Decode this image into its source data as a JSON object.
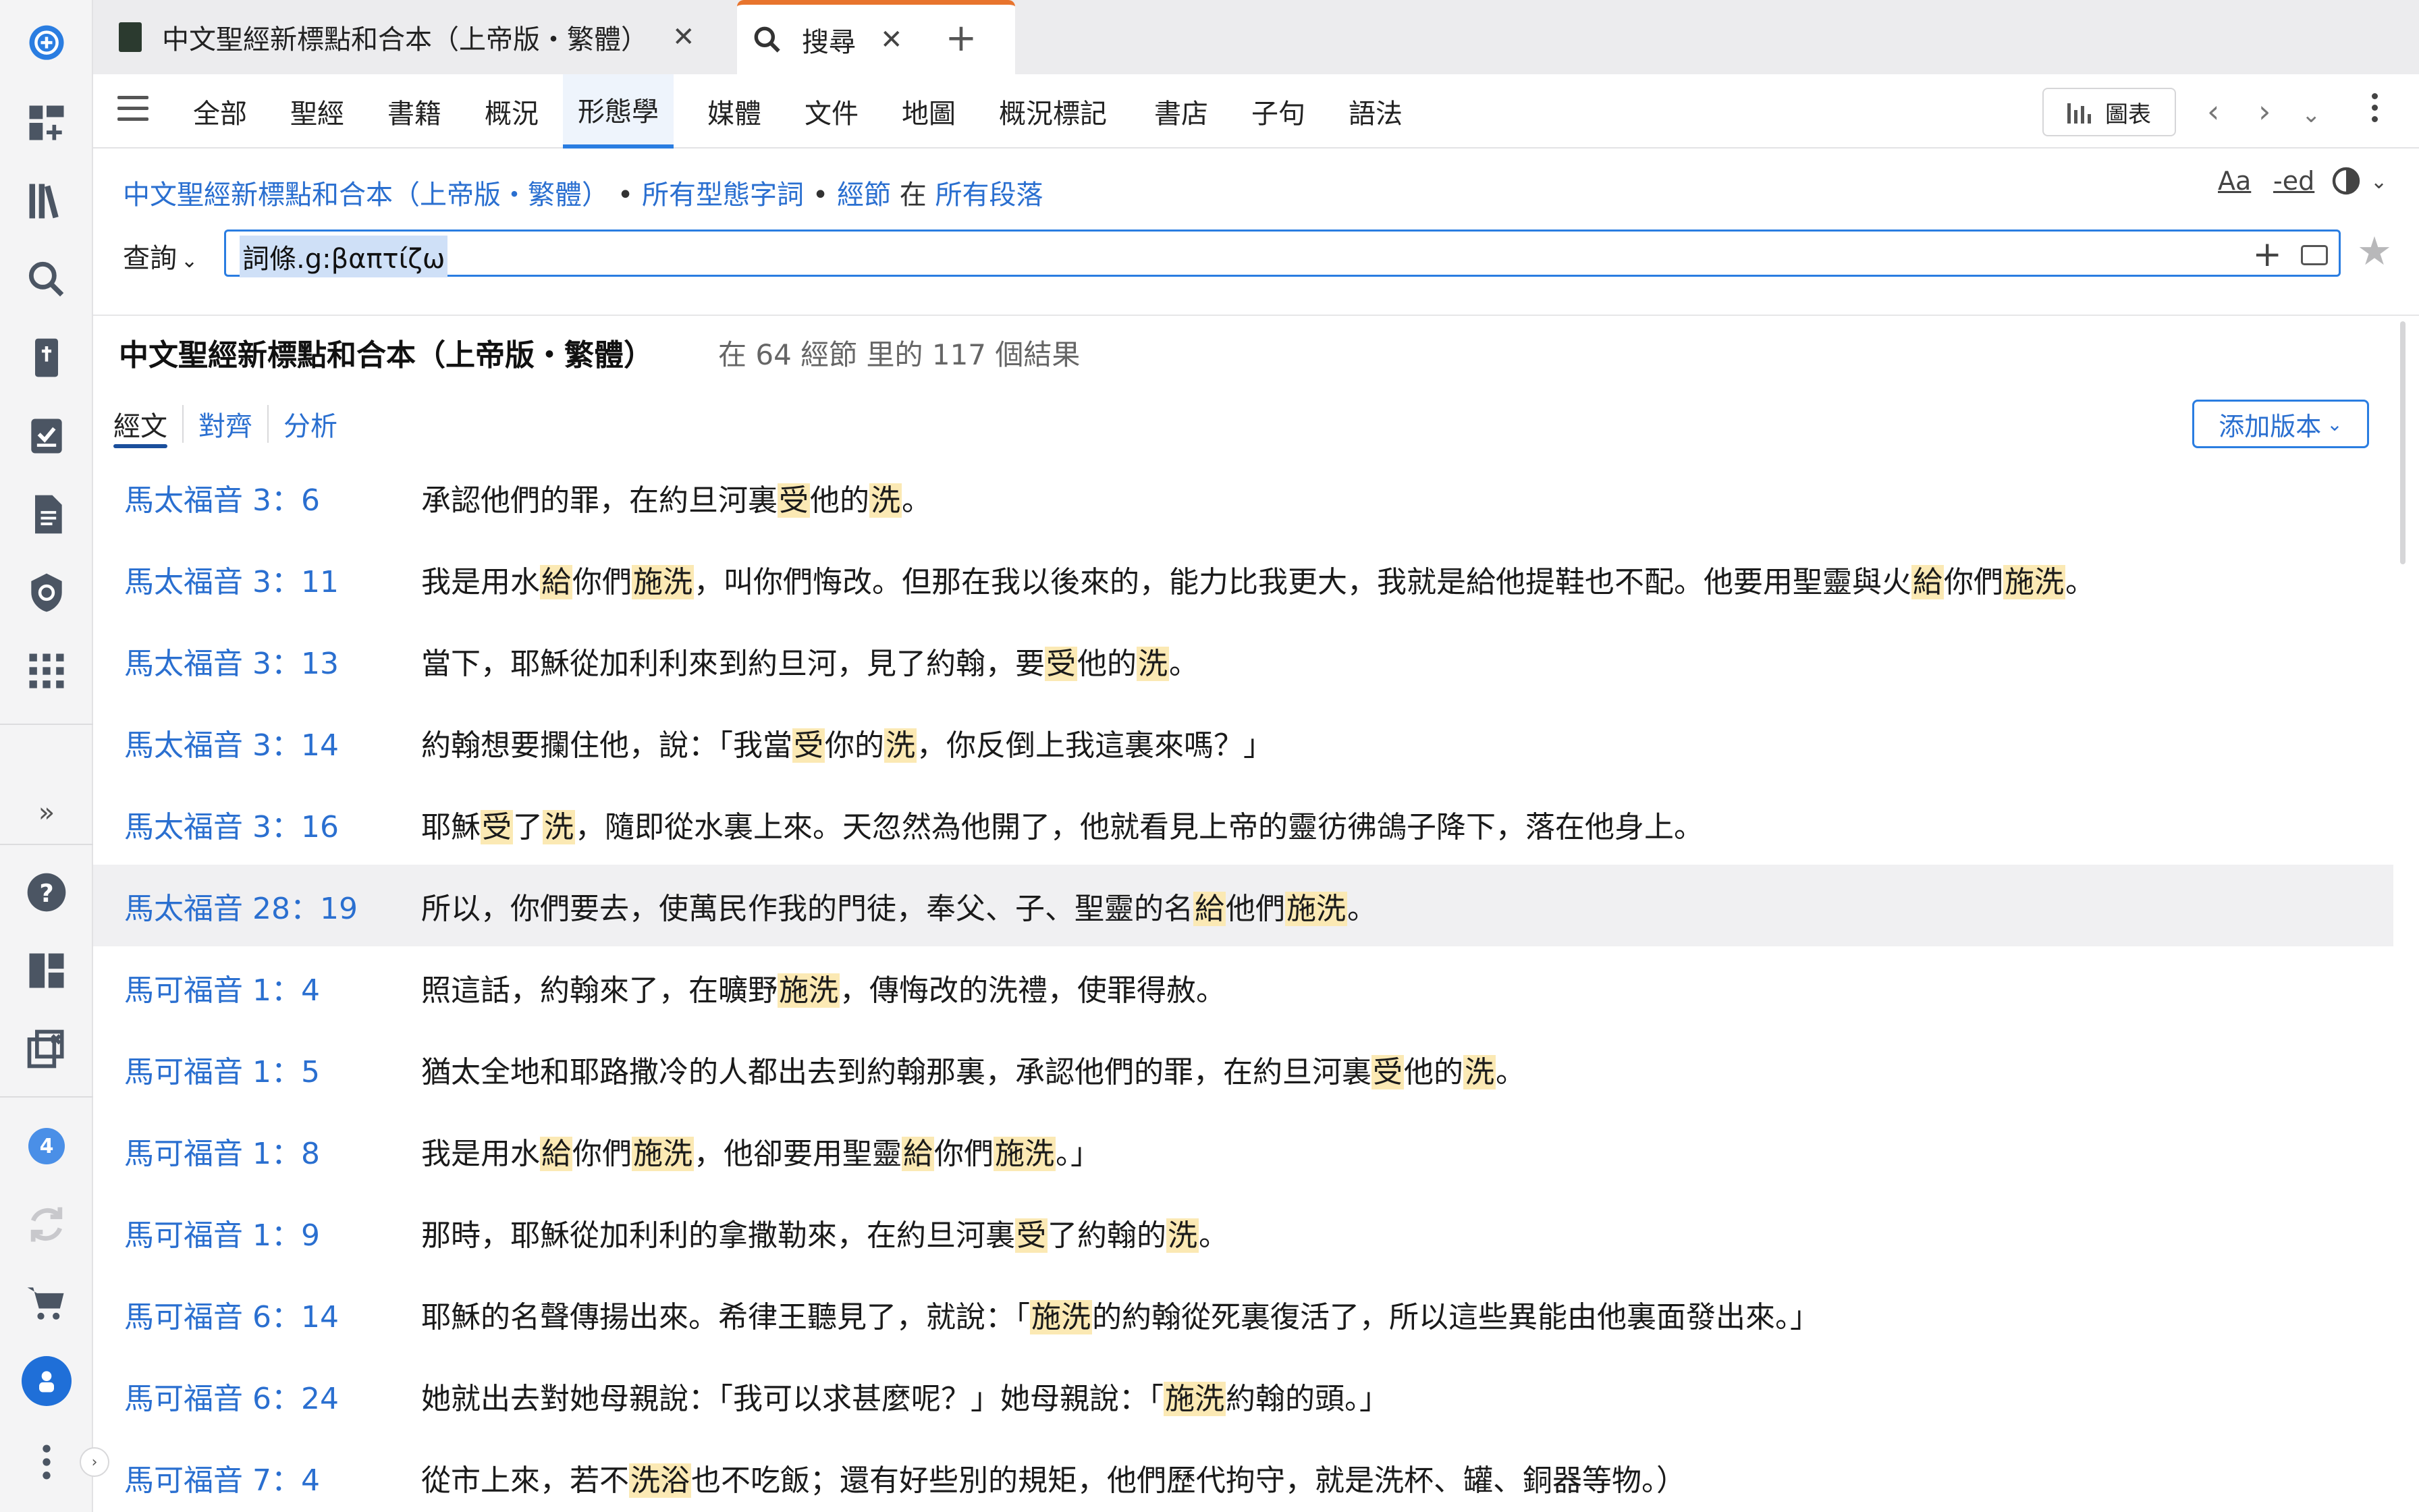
{
  "tabs": [
    {
      "label": "中文聖經新標點和合本（上帝版・繁體）",
      "close": "✕"
    },
    {
      "label": "搜尋",
      "close": "✕"
    }
  ],
  "toolbar": {
    "tabs": [
      "全部",
      "聖經",
      "書籍",
      "概況",
      "形態學",
      "媒體",
      "文件",
      "地圖",
      "概況標記",
      "書店",
      "子句",
      "語法"
    ],
    "active": "形態學",
    "chart_label": "圖表"
  },
  "breadcrumb": {
    "resource": "中文聖經新標點和合本（上帝版・繁體）",
    "forms": "所有型態字詞",
    "unit": "經節",
    "in": "在",
    "scope": "所有段落"
  },
  "view_icons": {
    "font": "Aa",
    "ed": "-ed"
  },
  "query": {
    "label": "查詢",
    "value": "詞條.g:βαπτίζω"
  },
  "results": {
    "title": "中文聖經新標點和合本（上帝版・繁體）",
    "count": "在 64 經節 里的 117 個結果"
  },
  "subtabs": [
    "經文",
    "對齊",
    "分析"
  ],
  "add_version": "添加版本",
  "rail": {
    "badge": "4",
    "expand": "»",
    "collapse": "›"
  },
  "verses": [
    {
      "ref": "馬太福音 3：6",
      "parts": [
        "承認他們的罪，在約旦河裏",
        "受",
        "他的",
        "洗",
        "。"
      ]
    },
    {
      "ref": "馬太福音 3：11",
      "parts": [
        "我是用水",
        "給",
        "你們",
        "施洗",
        "，叫你們悔改。但那在我以後來的，能力比我更大，我就是給他提鞋也不配。他要用聖靈與火",
        "給",
        "你們",
        "施洗",
        "。"
      ]
    },
    {
      "ref": "馬太福音 3：13",
      "parts": [
        "當下，耶穌從加利利來到約旦河，見了約翰，要",
        "受",
        "他的",
        "洗",
        "。"
      ]
    },
    {
      "ref": "馬太福音 3：14",
      "parts": [
        "約翰想要攔住他，說：「我當",
        "受",
        "你的",
        "洗",
        "，你反倒上我這裏來嗎？」"
      ]
    },
    {
      "ref": "馬太福音 3：16",
      "parts": [
        "耶穌",
        "受",
        "了",
        "洗",
        "，隨即從水裏上來。天忽然為他開了，他就看見上帝的靈彷彿鴿子降下，落在他身上。"
      ]
    },
    {
      "ref": "馬太福音 28：19",
      "parts": [
        "所以，你們要去，使萬民作我的門徒，奉父、子、聖靈的名",
        "給",
        "他們",
        "施洗",
        "。"
      ]
    },
    {
      "ref": "馬可福音 1：4",
      "parts": [
        "照這話，約翰來了，在曠野",
        "施洗",
        "，傳悔改的洗禮，使罪得赦。"
      ]
    },
    {
      "ref": "馬可福音 1：5",
      "parts": [
        "猶太全地和耶路撒冷的人都出去到約翰那裏，承認他們的罪，在約旦河裏",
        "受",
        "他的",
        "洗",
        "。"
      ]
    },
    {
      "ref": "馬可福音 1：8",
      "parts": [
        "我是用水",
        "給",
        "你們",
        "施洗",
        "，他卻要用聖靈",
        "給",
        "你們",
        "施洗",
        "。」"
      ]
    },
    {
      "ref": "馬可福音 1：9",
      "parts": [
        "那時，耶穌從加利利的拿撒勒來，在約旦河裏",
        "受",
        "了約翰的",
        "洗",
        "。"
      ]
    },
    {
      "ref": "馬可福音 6：14",
      "parts": [
        "耶穌的名聲傳揚出來。希律王聽見了，就說：「",
        "施洗",
        "的約翰從死裏復活了，所以這些異能由他裏面發出來。」"
      ]
    },
    {
      "ref": "馬可福音 6：24",
      "parts": [
        "她就出去對她母親說：「我可以求甚麼呢？」她母親說：「",
        "施洗",
        "約翰的頭。」"
      ]
    },
    {
      "ref": "馬可福音 7：4",
      "parts": [
        "從市上來，若不",
        "洗浴",
        "也不吃飯；還有好些別的規矩，他們歷代拘守，就是洗杯、罐、銅器等物。）"
      ]
    }
  ],
  "highlight_color": "#fbe9b4",
  "accent_color": "#2a7de1"
}
